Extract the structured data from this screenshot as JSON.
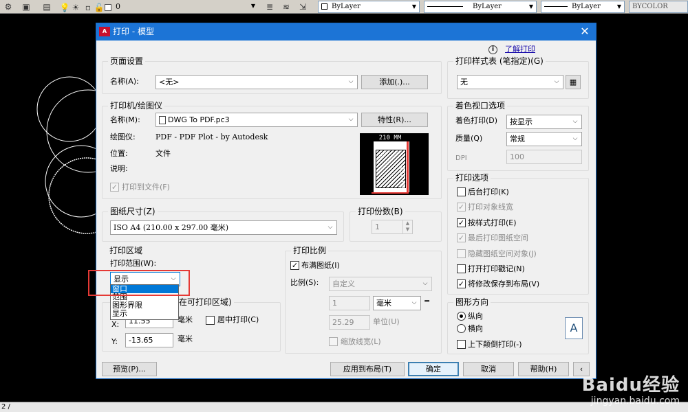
{
  "toolbar": {
    "layer_value": "0",
    "color": "ByLayer",
    "linetype": "ByLayer",
    "lineweight": "ByLayer",
    "plotstyle": "BYCOLOR"
  },
  "cmdbar": {
    "text": "2 /"
  },
  "dialog": {
    "title": "打印 - 模型",
    "help_link": "了解打印",
    "page_setup": {
      "legend": "页面设置",
      "name_label": "名称(A):",
      "name_value": "<无>",
      "add_button": "添加(.)..."
    },
    "printer": {
      "legend": "打印机/绘图仪",
      "name_label": "名称(M):",
      "name_value": "DWG To PDF.pc3",
      "properties_button": "特性(R)...",
      "plotter_label": "绘图仪:",
      "plotter_value": "PDF - PDF Plot - by Autodesk",
      "location_label": "位置:",
      "location_value": "文件",
      "description_label": "说明:",
      "plot_to_file": "打印到文件(F)",
      "preview_width": "210 MM",
      "preview_height": "297 MM"
    },
    "paper_size": {
      "legend": "图纸尺寸(Z)",
      "value": "ISO A4 (210.00 x 297.00 毫米)"
    },
    "copies": {
      "legend": "打印份数(B)",
      "value": "1"
    },
    "plot_area": {
      "legend": "打印区域",
      "range_label": "打印范围(W):",
      "range_value": "显示",
      "options": [
        "窗口",
        "范围",
        "图形界限",
        "显示"
      ]
    },
    "plot_offset": {
      "legend": "打印偏移(原点设置在可打印区域)",
      "legend_visible": "在可打印区域)",
      "x_label": "X:",
      "x_value": "11.55",
      "y_label": "Y:",
      "y_value": "-13.65",
      "unit": "毫米",
      "center": "居中打印(C)"
    },
    "plot_scale": {
      "legend": "打印比例",
      "fit_paper": "布满图纸(I)",
      "scale_label": "比例(S):",
      "scale_value": "自定义",
      "value1": "1",
      "unit1": "毫米",
      "equals": "=",
      "value2": "25.29",
      "unit2": "单位(U)",
      "scale_lineweights": "缩放线宽(L)"
    },
    "plot_style_table": {
      "legend": "打印样式表 (笔指定)(G)",
      "value": "无"
    },
    "shaded_viewport": {
      "legend": "着色视口选项",
      "shade_label": "着色打印(D)",
      "shade_value": "按显示",
      "quality_label": "质量(Q)",
      "quality_value": "常规",
      "dpi_label": "DPI",
      "dpi_value": "100"
    },
    "plot_options": {
      "legend": "打印选项",
      "items": [
        {
          "label": "后台打印(K)",
          "checked": false,
          "enabled": true
        },
        {
          "label": "打印对象线宽",
          "checked": true,
          "enabled": false
        },
        {
          "label": "按样式打印(E)",
          "checked": true,
          "enabled": true
        },
        {
          "label": "最后打印图纸空间",
          "checked": true,
          "enabled": false
        },
        {
          "label": "隐藏图纸空间对象(J)",
          "checked": false,
          "enabled": false
        },
        {
          "label": "打开打印戳记(N)",
          "checked": false,
          "enabled": true
        },
        {
          "label": "将修改保存到布局(V)",
          "checked": true,
          "enabled": true
        }
      ]
    },
    "orientation": {
      "legend": "图形方向",
      "portrait": "纵向",
      "landscape": "横向",
      "upside_down": "上下颠倒打印(-)",
      "icon_letter": "A"
    },
    "buttons": {
      "preview": "预览(P)...",
      "apply": "应用到布局(T)",
      "ok": "确定",
      "cancel": "取消",
      "help": "帮助(H)"
    }
  },
  "watermark": {
    "logo": "Baidu经验",
    "url": "jingyan.baidu.com"
  }
}
